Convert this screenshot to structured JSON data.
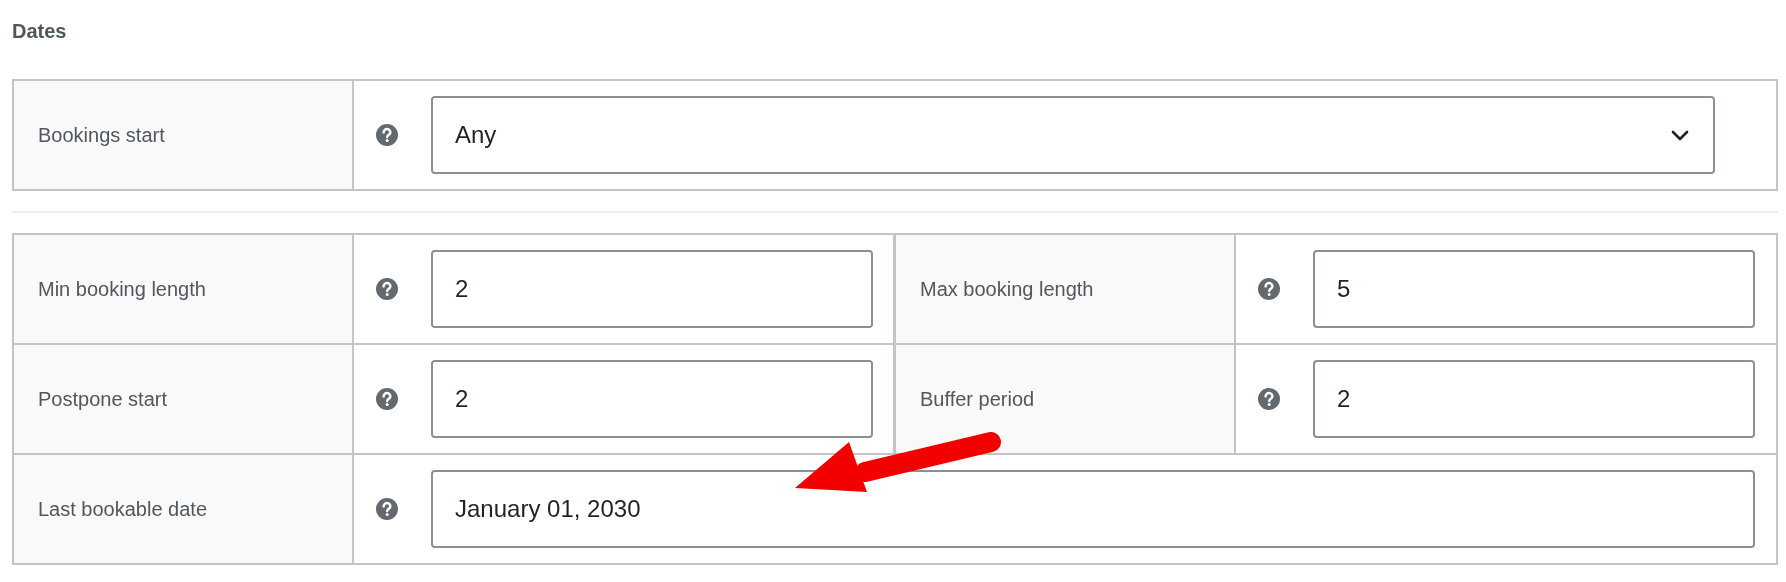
{
  "section_title": "Dates",
  "top_field": {
    "label": "Bookings start",
    "kind": "select",
    "value": "Any"
  },
  "rows": [
    [
      {
        "label": "Min booking length",
        "value": "2"
      },
      {
        "label": "Max booking length",
        "value": "5"
      }
    ],
    [
      {
        "label": "Postpone start",
        "value": "2"
      },
      {
        "label": "Buffer period",
        "value": "2"
      }
    ],
    [
      {
        "label": "Last bookable date",
        "value": "January 01, 2030"
      }
    ]
  ]
}
